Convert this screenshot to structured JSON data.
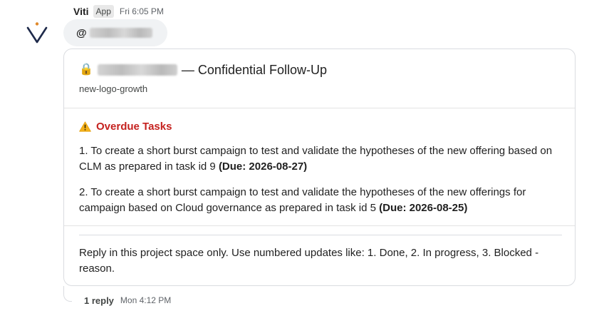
{
  "message": {
    "sender": "Viti",
    "badge": "App",
    "timestamp": "Fri 6:05 PM",
    "mention_prefix": "@"
  },
  "card": {
    "title_suffix": "— Confidential Follow-Up",
    "subtitle": "new-logo-growth",
    "section_title": "Overdue Tasks",
    "tasks": [
      {
        "text": "1. To create a short burst campaign to test and validate the hypotheses of the new offering based on CLM as prepared in task id 9",
        "due": "(Due: 2026-08-27)"
      },
      {
        "text": "2. To create a short burst campaign to test and validate the hypotheses of the new offerings for campaign based on Cloud governance as prepared in task id 5",
        "due": "(Due: 2026-08-25)"
      }
    ],
    "reply_note": "Reply in this project space only. Use numbered updates like: 1. Done, 2. In progress, 3. Blocked - reason."
  },
  "thread": {
    "reply_count": "1 reply",
    "last_reply_time": "Mon 4:12 PM"
  },
  "icons": {
    "avatar": "viti-logo-icon",
    "title": "lock-icon",
    "section": "warning-icon"
  },
  "colors": {
    "section_title": "#c5221f",
    "avatar_navy": "#1e2a4a",
    "avatar_accent": "#e0892b"
  }
}
